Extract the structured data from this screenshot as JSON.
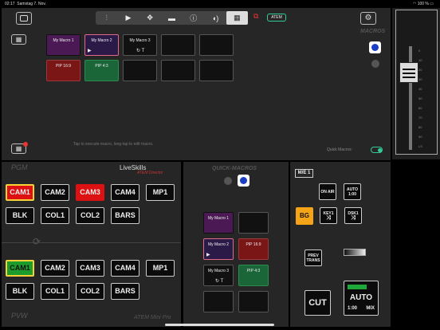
{
  "status": {
    "time": "02:17",
    "date": "Samstag 7. Nov.",
    "battery": "100 %",
    "wifi_icon": "wifi-icon",
    "battery_icon": "battery-icon"
  },
  "toolbar": {
    "segments": [
      {
        "icon": "sliders-icon",
        "glyph": "⫶"
      },
      {
        "icon": "play-icon",
        "glyph": "▶"
      },
      {
        "icon": "move-icon",
        "glyph": "✥"
      },
      {
        "icon": "layout-icon",
        "glyph": "▬"
      },
      {
        "icon": "info-icon",
        "glyph": "ⓘ"
      },
      {
        "icon": "audio-icon",
        "glyph": "◖)"
      },
      {
        "icon": "macro-grid-icon",
        "glyph": "▦"
      }
    ],
    "atem_label": "ATEM"
  },
  "macros_panel": {
    "title": "MACROS",
    "hint": "Tap to execute macro, long-tap to edit macro.",
    "quick_macros_label": "Quick Macros:",
    "grid": [
      {
        "label": "My Macro 1",
        "style": "purple",
        "icon": ""
      },
      {
        "label": "My Macro 2",
        "style": "selected",
        "icon": "▶"
      },
      {
        "label": "My Macro 3",
        "style": "black",
        "icon": "↻ T"
      },
      {
        "label": "",
        "style": "black",
        "icon": ""
      },
      {
        "label": "",
        "style": "black",
        "icon": ""
      },
      {
        "label": "PIP 16:9",
        "style": "red",
        "icon": ""
      },
      {
        "label": "PIP 4:3",
        "style": "green",
        "icon": ""
      },
      {
        "label": "",
        "style": "black",
        "icon": ""
      },
      {
        "label": "",
        "style": "black",
        "icon": ""
      },
      {
        "label": "",
        "style": "black",
        "icon": ""
      }
    ]
  },
  "switcher": {
    "pgm_label": "PGM",
    "pvw_label": "PVW",
    "brand": "LiveSkills",
    "brand_sub": "ATEM Director",
    "model": "ATEM Mini Pro",
    "pgm_row1": [
      "CAM1",
      "CAM2",
      "CAM3",
      "CAM4",
      "MP1"
    ],
    "pgm_row2": [
      "BLK",
      "COL1",
      "COL2",
      "BARS"
    ],
    "pvw_row1": [
      "CAM1",
      "CAM2",
      "CAM3",
      "CAM4",
      "MP1"
    ],
    "pvw_row2": [
      "BLK",
      "COL1",
      "COL2",
      "BARS"
    ]
  },
  "quick_macros": {
    "title": "QUICK-MACROS",
    "items": [
      {
        "label": "My Macro 1",
        "style": "purple",
        "icon": ""
      },
      {
        "label": "",
        "style": "black",
        "icon": ""
      },
      {
        "label": "My Macro 2",
        "style": "selected",
        "icon": "▶"
      },
      {
        "label": "PIP 16:9",
        "style": "red",
        "icon": ""
      },
      {
        "label": "My Macro 3",
        "style": "black",
        "icon": "↻ T"
      },
      {
        "label": "PIP 4:3",
        "style": "green",
        "icon": ""
      },
      {
        "label": "",
        "style": "black",
        "icon": ""
      },
      {
        "label": "",
        "style": "black",
        "icon": ""
      }
    ]
  },
  "transition": {
    "me_label": "M/E 1",
    "on_air": "ON AIR",
    "auto_small": "AUTO 1:00",
    "bg": "BG",
    "key1": "KEY1",
    "dsk1": "DSK1",
    "prev_trans": "PREV TRANS",
    "cut": "CUT",
    "auto": "AUTO",
    "auto_rate": "1:00",
    "auto_mix": "MIX"
  },
  "tbar": {
    "ticks": [
      "0",
      "10",
      "20",
      "30",
      "40",
      "50",
      "60",
      "70",
      "80",
      "90",
      "LS"
    ]
  }
}
